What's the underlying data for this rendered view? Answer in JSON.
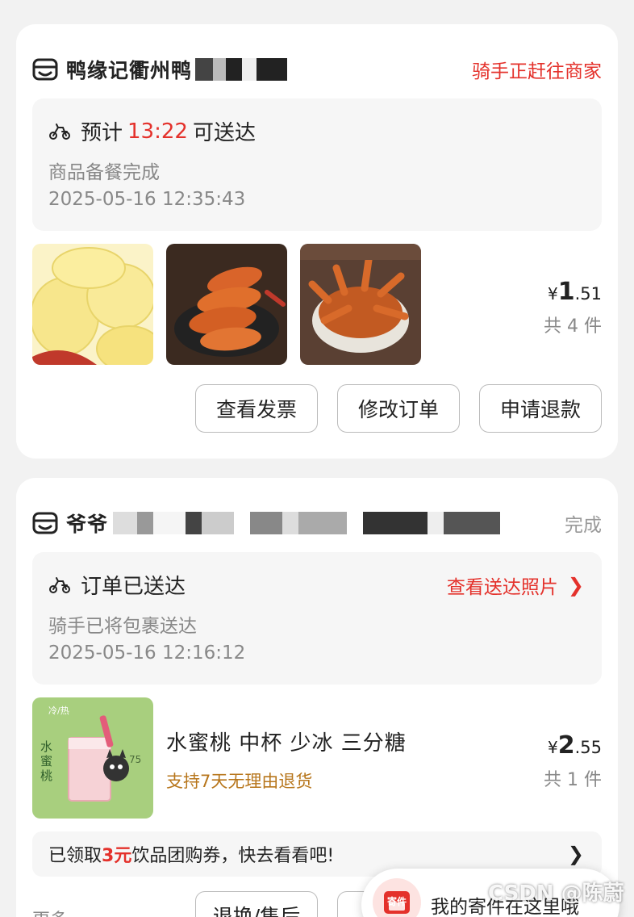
{
  "order1": {
    "shop_name": "鸭缘记衢州鸭",
    "status": "骑手正赶往商家",
    "eta_prefix": "预计",
    "eta_time": "13:22",
    "eta_suffix": "可送达",
    "sub_status": "商品备餐完成",
    "timestamp": "2025-05-16 12:35:43",
    "products": [
      {
        "name": "potato-slices-photo"
      },
      {
        "name": "sausage-photo"
      },
      {
        "name": "chicken-feet-photo"
      }
    ],
    "price_symbol": "¥",
    "price_int": "1",
    "price_dec": ".51",
    "count": "共 4 件",
    "buttons": [
      "查看发票",
      "修改订单",
      "申请退款"
    ]
  },
  "order2": {
    "shop_name": "爷爷",
    "status": "完成",
    "delivered_title": "订单已送达",
    "photo_link": "查看送达照片",
    "sub_status": "骑手已将包裹送达",
    "timestamp": "2025-05-16 12:16:12",
    "product_title": "水蜜桃 中杯 少冰 三分糖",
    "product_policy": "支持7天无理由退货",
    "price_symbol": "¥",
    "price_int": "2",
    "price_dec": ".55",
    "count": "共 1 件",
    "coupon_prefix": "已领取",
    "coupon_amount": "3元",
    "coupon_suffix": "饮品团购券，快去看看吧!",
    "more_label": "更多",
    "buttons": [
      "退换/售后"
    ],
    "drink_label_top": "冷/热",
    "drink_label_side": "水蜜桃",
    "drink_label_right": "75"
  },
  "floater": {
    "icon_text": "寄件",
    "text": "我的寄件在这里哦"
  },
  "watermark": "CSDN @陈蔚",
  "colors": {
    "accent_red": "#e4312b",
    "policy_brown": "#b7761c",
    "muted_grey": "#888888"
  }
}
